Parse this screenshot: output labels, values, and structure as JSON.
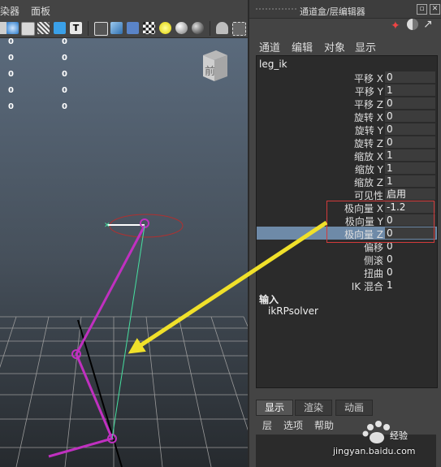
{
  "viewport": {
    "menu": [
      "染器",
      "面板"
    ],
    "hud_values": [
      [
        "0",
        "0"
      ],
      [
        "0",
        "0"
      ],
      [
        "0",
        "0"
      ],
      [
        "0",
        "0"
      ],
      [
        "0",
        "0"
      ]
    ],
    "viewcube_label": "前"
  },
  "panel": {
    "title": "通道盒/层编辑器",
    "menus": [
      "通道",
      "编辑",
      "对象",
      "显示"
    ],
    "node": "leg_ik",
    "attributes": [
      {
        "label": "平移 X",
        "value": "0"
      },
      {
        "label": "平移 Y",
        "value": "1"
      },
      {
        "label": "平移 Z",
        "value": "0"
      },
      {
        "label": "旋转 X",
        "value": "0"
      },
      {
        "label": "旋转 Y",
        "value": "0"
      },
      {
        "label": "旋转 Z",
        "value": "0"
      },
      {
        "label": "缩放 X",
        "value": "1"
      },
      {
        "label": "缩放 Y",
        "value": "1"
      },
      {
        "label": "缩放 Z",
        "value": "1"
      },
      {
        "label": "可见性",
        "value": "启用"
      },
      {
        "label": "极向量 X",
        "value": "-1.2"
      },
      {
        "label": "极向量 Y",
        "value": "0"
      },
      {
        "label": "极向量 Z",
        "value": "0"
      },
      {
        "label": "偏移",
        "value": "0"
      },
      {
        "label": "侧滚",
        "value": "0"
      },
      {
        "label": "扭曲",
        "value": "0"
      },
      {
        "label": "IK 混合",
        "value": "1"
      }
    ],
    "inputs_header": "输入",
    "solver": "ikRPsolver"
  },
  "layers": {
    "tabs": [
      "显示",
      "渲染",
      "动画"
    ],
    "menu": [
      "层",
      "选项",
      "帮助"
    ]
  },
  "watermark": {
    "text": "jingyan.baidu.com"
  },
  "colors": {
    "highlight_row": "#6e8aa8",
    "annotation_box": "#d23a3a",
    "annotation_arrow": "#f0e02a",
    "joint_chain": "#c030c0",
    "pole_line": "#46e0a0"
  }
}
